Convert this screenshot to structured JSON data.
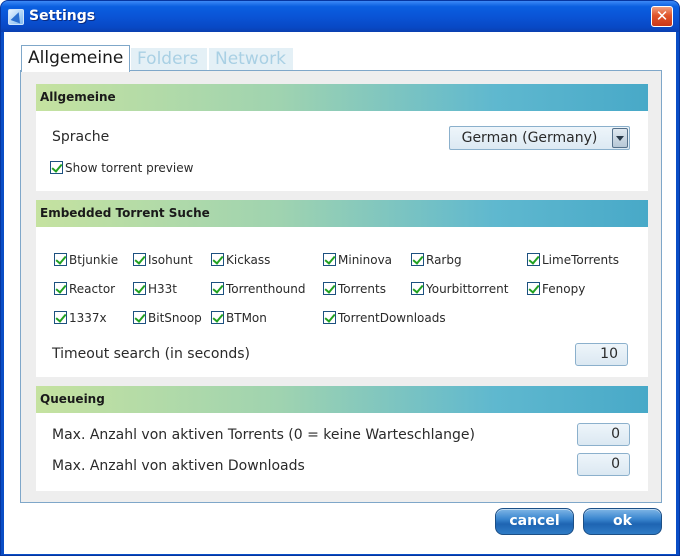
{
  "window": {
    "title": "Settings",
    "close_glyph": "✕",
    "icon": "app-icon"
  },
  "tabs": [
    {
      "label": "Allgemeine",
      "active": true
    },
    {
      "label": "Folders",
      "active": false
    },
    {
      "label": "Network",
      "active": false
    }
  ],
  "general": {
    "header": "Allgemeine",
    "language_label": "Sprache",
    "language_value": "German (Germany)",
    "show_preview_label": "Show torrent preview",
    "show_preview_checked": true
  },
  "embedded": {
    "header": "Embedded Torrent Suche",
    "sites": [
      {
        "label": "Btjunkie",
        "checked": true
      },
      {
        "label": "Isohunt",
        "checked": true
      },
      {
        "label": "Kickass",
        "checked": true
      },
      {
        "label": "Mininova",
        "checked": true
      },
      {
        "label": "Rarbg",
        "checked": true
      },
      {
        "label": "LimeTorrents",
        "checked": true
      },
      {
        "label": "Reactor",
        "checked": true
      },
      {
        "label": "H33t",
        "checked": true
      },
      {
        "label": "Torrenthound",
        "checked": true
      },
      {
        "label": "Torrents",
        "checked": true
      },
      {
        "label": "Yourbittorrent",
        "checked": true
      },
      {
        "label": "Fenopy",
        "checked": true
      },
      {
        "label": "1337x",
        "checked": true
      },
      {
        "label": "BitSnoop",
        "checked": true
      },
      {
        "label": "BTMon",
        "checked": true
      },
      {
        "label": "TorrentDownloads",
        "checked": true
      }
    ],
    "timeout_label": "Timeout search (in seconds)",
    "timeout_value": "10"
  },
  "queueing": {
    "header": "Queueing",
    "max_torrents_label": "Max. Anzahl von aktiven Torrents (0 = keine Warteschlange)",
    "max_torrents_value": "0",
    "max_downloads_label": "Max. Anzahl von aktiven Downloads",
    "max_downloads_value": "0"
  },
  "buttons": {
    "cancel": "cancel",
    "ok": "ok"
  },
  "colors": {
    "titlebar": "#0a54d6",
    "header_gradient_start": "#c5e2a0",
    "header_gradient_end": "#48a9c8",
    "button_blue": "#2f7cc6",
    "checkmark": "#21a121"
  }
}
